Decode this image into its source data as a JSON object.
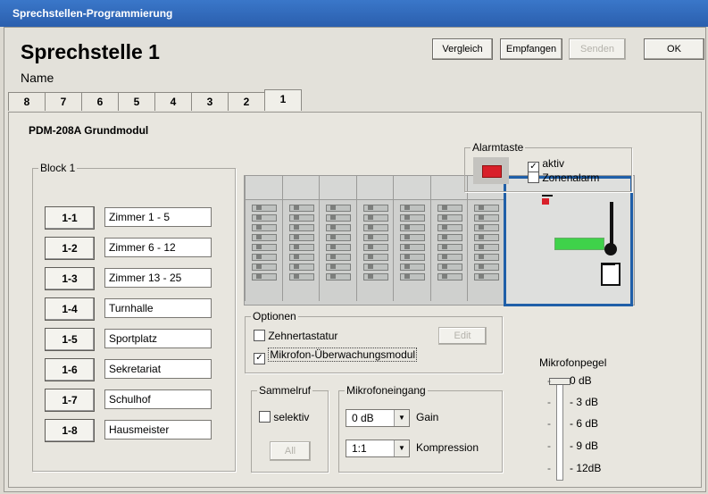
{
  "window": {
    "title": "Sprechstellen-Programmierung"
  },
  "header": {
    "station_title": "Sprechstelle 1",
    "name_label": "Name"
  },
  "toolbar": {
    "compare_label": "Vergleich",
    "receive_label": "Empfangen",
    "send_label": "Senden",
    "ok_label": "OK"
  },
  "tabs": [
    "8",
    "7",
    "6",
    "5",
    "4",
    "3",
    "2",
    "1"
  ],
  "module": {
    "title": "PDM-208A Grundmodul"
  },
  "block": {
    "legend": "Block 1",
    "keys": [
      {
        "id": "1-1",
        "value": "Zimmer 1 - 5"
      },
      {
        "id": "1-2",
        "value": "Zimmer 6 - 12"
      },
      {
        "id": "1-3",
        "value": "Zimmer 13 - 25"
      },
      {
        "id": "1-4",
        "value": "Turnhalle"
      },
      {
        "id": "1-5",
        "value": "Sportplatz"
      },
      {
        "id": "1-6",
        "value": "Sekretariat"
      },
      {
        "id": "1-7",
        "value": "Schulhof"
      },
      {
        "id": "1-8",
        "value": "Hausmeister"
      }
    ]
  },
  "alarm": {
    "legend": "Alarmtaste",
    "active_label": "aktiv",
    "active_checked": true,
    "zone_label": "Zonenalarm",
    "zone_checked": false
  },
  "options": {
    "legend": "Optionen",
    "keypad_label": "Zehnertastatur",
    "keypad_checked": false,
    "edit_label": "Edit",
    "mic_monitor_label": "Mikrofon-Überwachungsmodul",
    "mic_monitor_checked": true
  },
  "group_call": {
    "legend": "Sammelruf",
    "selective_label": "selektiv",
    "selective_checked": false,
    "all_label": "All"
  },
  "mic_input": {
    "legend": "Mikrofoneingang",
    "gain_value": "0 dB",
    "gain_label": "Gain",
    "compression_value": "1:1",
    "compression_label": "Kompression"
  },
  "mic_level": {
    "title": "Mikrofonpegel",
    "ticks": [
      "0 dB",
      "- 3 dB",
      "- 6 dB",
      "- 9 dB",
      "- 12dB"
    ],
    "value_db": 0
  },
  "colors": {
    "title_bar": "#2b5fae",
    "alarm_button": "#d8202a",
    "module_highlight": "#1f5fa8",
    "display_green": "#3fd24a"
  }
}
